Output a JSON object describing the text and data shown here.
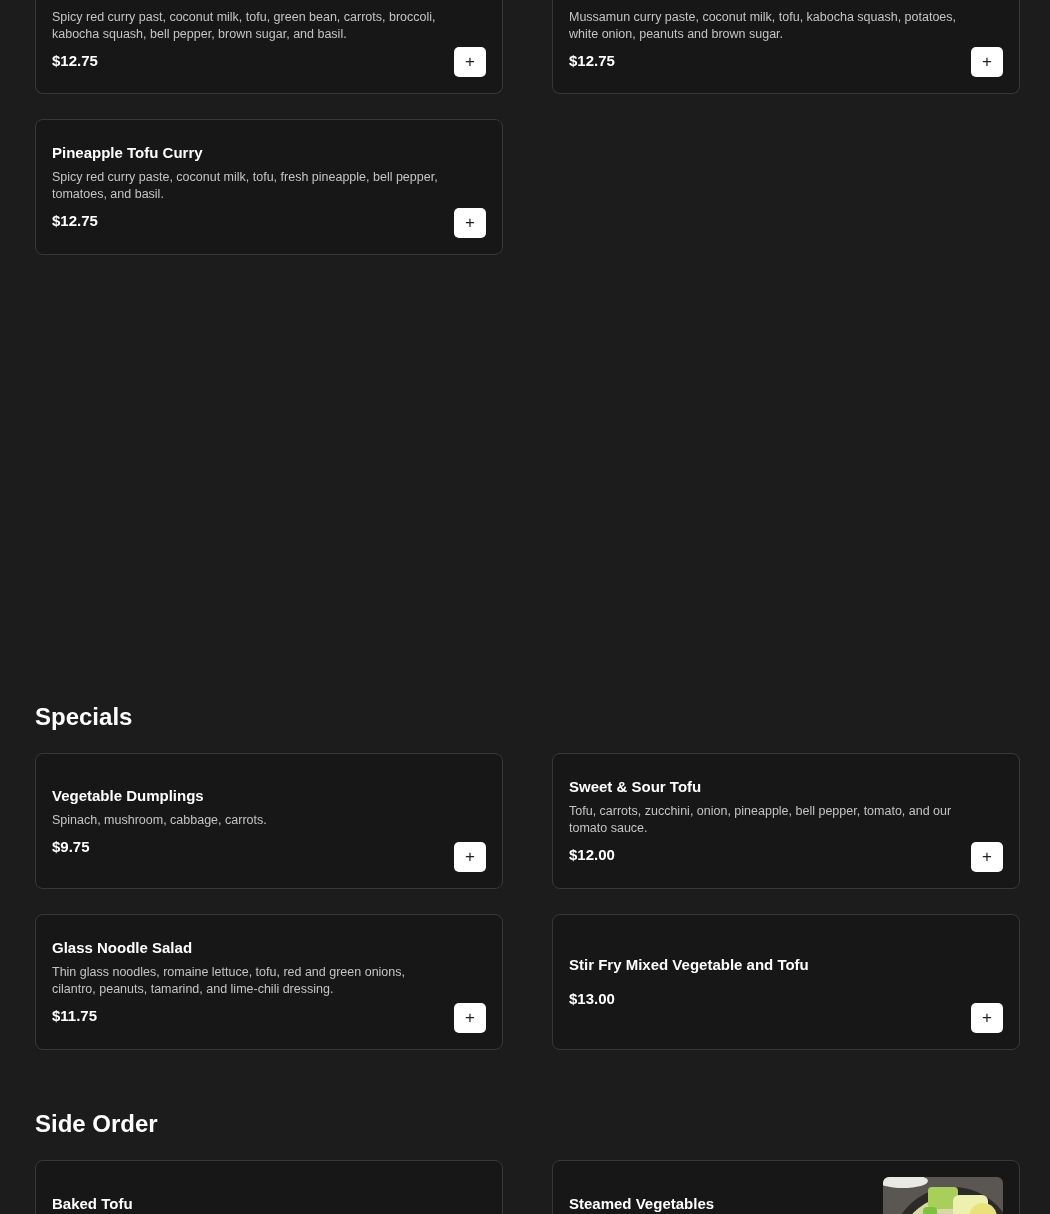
{
  "sections": [
    {
      "items": [
        {
          "description": "Spicy red curry past, coconut milk, tofu, green bean, carrots, broccoli, kabocha squash, bell pepper, brown sugar, and basil.",
          "price": "$12.75",
          "add_button": "+"
        },
        {
          "description": "Mussamun curry paste, coconut milk, tofu, kabocha squash, potatoes, white onion, peanuts and brown sugar.",
          "price": "$12.75",
          "add_button": "+"
        },
        {
          "name": "Pineapple Tofu Curry",
          "description": "Spicy red curry paste, coconut milk, tofu, fresh pineapple, bell pepper, tomatoes, and basil.",
          "price": "$12.75",
          "add_button": "+"
        }
      ]
    },
    {
      "title": "Specials",
      "items": [
        {
          "name": "Vegetable Dumplings",
          "description": "Spinach, mushroom, cabbage, carrots.",
          "price": "$9.75",
          "add_button": "+"
        },
        {
          "name": "Sweet & Sour Tofu",
          "description": "Tofu, carrots, zucchini, onion, pineapple, bell pepper, tomato, and our tomato sauce.",
          "price": "$12.00",
          "add_button": "+"
        },
        {
          "name": "Glass Noodle Salad",
          "description": "Thin glass noodles, romaine lettuce, tofu, red and green onions, cilantro, peanuts, tamarind, and lime-chili dressing.",
          "price": "$11.75",
          "add_button": "+"
        },
        {
          "name": "Stir Fry Mixed Vegetable and Tofu",
          "price": "$13.00",
          "add_button": "+"
        }
      ]
    },
    {
      "title": "Side Order",
      "items": [
        {
          "name": "Baked Tofu"
        },
        {
          "name": "Steamed Vegetables"
        }
      ]
    }
  ]
}
